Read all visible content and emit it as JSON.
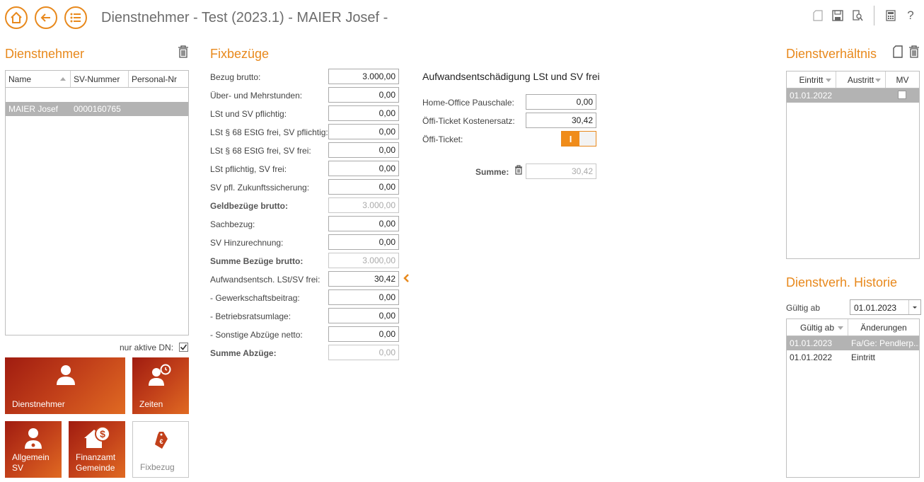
{
  "header": {
    "title": "Dienstnehmer - Test  (2023.1) - MAIER Josef -"
  },
  "left": {
    "title": "Dienstnehmer",
    "grid": {
      "columns": [
        "Name",
        "SV-Nummer",
        "Personal-Nr"
      ],
      "rows": [
        {
          "name": "MAIER Josef",
          "sv": "0000160765",
          "pnr": ""
        }
      ]
    },
    "filter_label": "nur aktive DN:",
    "filter_checked": true,
    "tiles": {
      "dienstnehmer": "Dienstnehmer",
      "zeiten": "Zeiten",
      "allgemein": "Allgemein\nSV",
      "finanzamt": "Finanzamt\nGemeinde",
      "fixbezug": "Fixbezug"
    }
  },
  "fix": {
    "title": "Fixbezüge",
    "fields": [
      {
        "label": "Bezug brutto:",
        "value": "3.000,00",
        "bold": false,
        "ro": false
      },
      {
        "label": "Über- und Mehrstunden:",
        "value": "0,00",
        "bold": false,
        "ro": false
      },
      {
        "label": "LSt und SV pflichtig:",
        "value": "0,00",
        "bold": false,
        "ro": false
      },
      {
        "label": "LSt § 68 EStG frei, SV pflichtig:",
        "value": "0,00",
        "bold": false,
        "ro": false
      },
      {
        "label": "LSt § 68 EStG frei, SV frei:",
        "value": "0,00",
        "bold": false,
        "ro": false
      },
      {
        "label": "LSt pflichtig, SV frei:",
        "value": "0,00",
        "bold": false,
        "ro": false
      },
      {
        "label": "SV pfl. Zukunftssicherung:",
        "value": "0,00",
        "bold": false,
        "ro": false
      },
      {
        "label": "Geldbezüge brutto:",
        "value": "3.000,00",
        "bold": true,
        "ro": true
      },
      {
        "label": "Sachbezug:",
        "value": "0,00",
        "bold": false,
        "ro": false
      },
      {
        "label": "SV Hinzurechnung:",
        "value": "0,00",
        "bold": false,
        "ro": false
      },
      {
        "label": "Summe Bezüge brutto:",
        "value": "3.000,00",
        "bold": true,
        "ro": true
      },
      {
        "label": "Aufwandsentsch. LSt/SV frei:",
        "value": "30,42",
        "bold": false,
        "ro": false
      },
      {
        "label": "- Gewerkschaftsbeitrag:",
        "value": "0,00",
        "bold": false,
        "ro": false
      },
      {
        "label": "- Betriebsratsumlage:",
        "value": "0,00",
        "bold": false,
        "ro": false
      },
      {
        "label": "- Sonstige Abzüge netto:",
        "value": "0,00",
        "bold": false,
        "ro": false
      },
      {
        "label": "Summe Abzüge:",
        "value": "0,00",
        "bold": true,
        "ro": true
      }
    ]
  },
  "aufwand": {
    "title": "Aufwandsentschädigung LSt und SV frei",
    "home_office_label": "Home-Office Pauschale:",
    "home_office_value": "0,00",
    "oeffi_kosten_label": "Öffi-Ticket Kostenersatz:",
    "oeffi_kosten_value": "30,42",
    "oeffi_ticket_label": "Öffi-Ticket:",
    "oeffi_ticket_toggle": "I",
    "summe_label": "Summe:",
    "summe_value": "30,42"
  },
  "dv": {
    "title": "Dienstverhältnis",
    "columns": [
      "Eintritt",
      "Austritt",
      "MV"
    ],
    "rows": [
      {
        "eintritt": "01.01.2022",
        "austritt": "",
        "mv": false
      }
    ]
  },
  "historie": {
    "title": "Dienstverh. Historie",
    "gueltig_label": "Gültig ab",
    "gueltig_value": "01.01.2023",
    "columns": [
      "Gültig ab",
      "Änderungen"
    ],
    "rows": [
      {
        "datum": "01.01.2023",
        "aenderung": "Fa/Ge: Pendlerp..."
      },
      {
        "datum": "01.01.2022",
        "aenderung": "Eintritt"
      }
    ]
  }
}
